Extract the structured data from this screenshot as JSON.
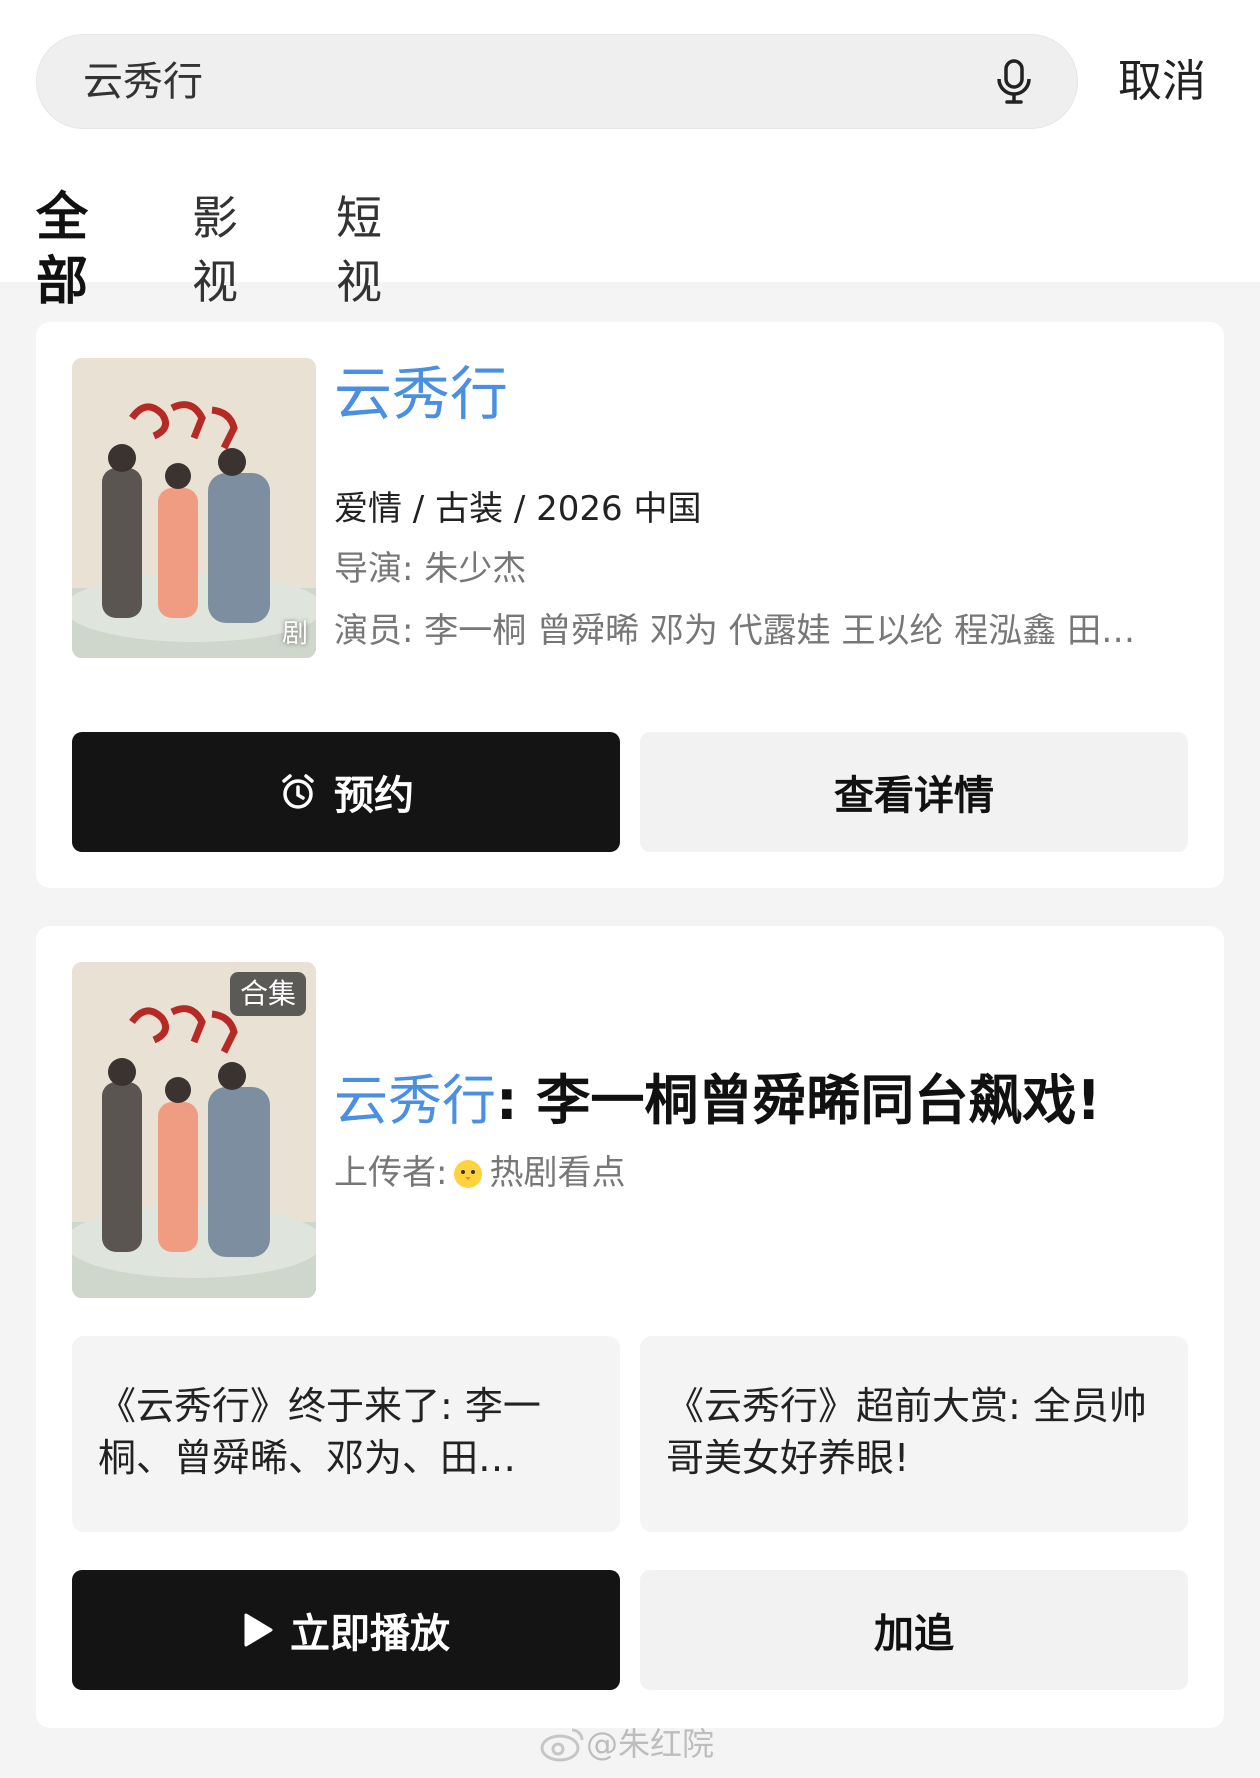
{
  "search": {
    "query": "云秀行",
    "cancel_label": "取消"
  },
  "tabs": [
    "全部",
    "影视",
    "短视频"
  ],
  "card1": {
    "title": "云秀行",
    "meta": "爱情 / 古装 / 2026 中国",
    "director": "导演: 朱少杰",
    "cast": "演员: 李一桐 曾舜晞 邓为 代露娃 王以纶 程泓鑫 田…",
    "badge": "剧",
    "primary_button": "预约",
    "secondary_button": "查看详情"
  },
  "card2": {
    "badge": "合集",
    "title_highlight": "云秀行",
    "title_rest": ": 李一桐曾舜晞同台飙戏!",
    "uploader_label": "上传者:",
    "uploader_name": "热剧看点",
    "clips": [
      "《云秀行》终于来了: 李一桐、曾舜晞、邓为、田…",
      "《云秀行》超前大赏: 全员帅哥美女好养眼!"
    ],
    "primary_button": "立即播放",
    "secondary_button": "加追"
  },
  "watermark": "@朱红院",
  "colors": {
    "title_blue": "#4a8fe2",
    "dark_button": "#141414",
    "background": "#f4f4f4"
  }
}
